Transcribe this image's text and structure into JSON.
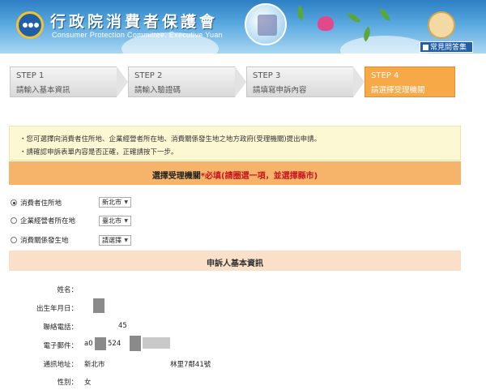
{
  "header": {
    "title": "行政院消費者保護會",
    "subtitle": "Consumer Protection Committee, Executive Yuan",
    "faq_button": "常見問答集"
  },
  "steps": [
    {
      "title": "STEP 1",
      "desc": "請輸入基本資訊",
      "active": false
    },
    {
      "title": "STEP 2",
      "desc": "請輸入驗證碼",
      "active": false
    },
    {
      "title": "STEP 3",
      "desc": "請填寫申訴內容",
      "active": false
    },
    {
      "title": "STEP 4",
      "desc": "請選擇受理機關",
      "active": true
    }
  ],
  "notice": {
    "lines": [
      "・您可選擇向消費者住所地、企業經營者所在地、消費關係發生地之地方政府(受理機關)提出申請。",
      "・請確認申訴表單內容是否正確，正確請按下一步。"
    ]
  },
  "select_bar": {
    "label": "選擇受理機關",
    "required": "*必填(請圈選一項，並選擇縣市)"
  },
  "options": [
    {
      "label": "消費者住所地",
      "value": "新北市",
      "checked": true
    },
    {
      "label": "企業經營者所在地",
      "value": "臺北市",
      "checked": false
    },
    {
      "label": "消費關係發生地",
      "value": "請選擇",
      "checked": false
    }
  ],
  "section": {
    "title": "申訴人基本資訊"
  },
  "info": {
    "name_label": "姓名：",
    "name_value": "",
    "birth_label": "出生年月日：",
    "birth_value": "",
    "phone_label": "聯絡電話：",
    "phone_value": "45",
    "email_label": "電子郵件：",
    "email_value_a": "a0",
    "email_value_b": "524",
    "address_label": "通訊地址：",
    "address_value_a": "新北市",
    "address_value_b": "林里7鄰41號",
    "gender_label": "性別：",
    "gender_value": "女"
  },
  "colors": {
    "active_step": "#f7a847",
    "select_bar": "#f6b46b",
    "section_head": "#fae0c8",
    "notice_bg": "#fdf8d4",
    "required_text": "#c9151e"
  }
}
